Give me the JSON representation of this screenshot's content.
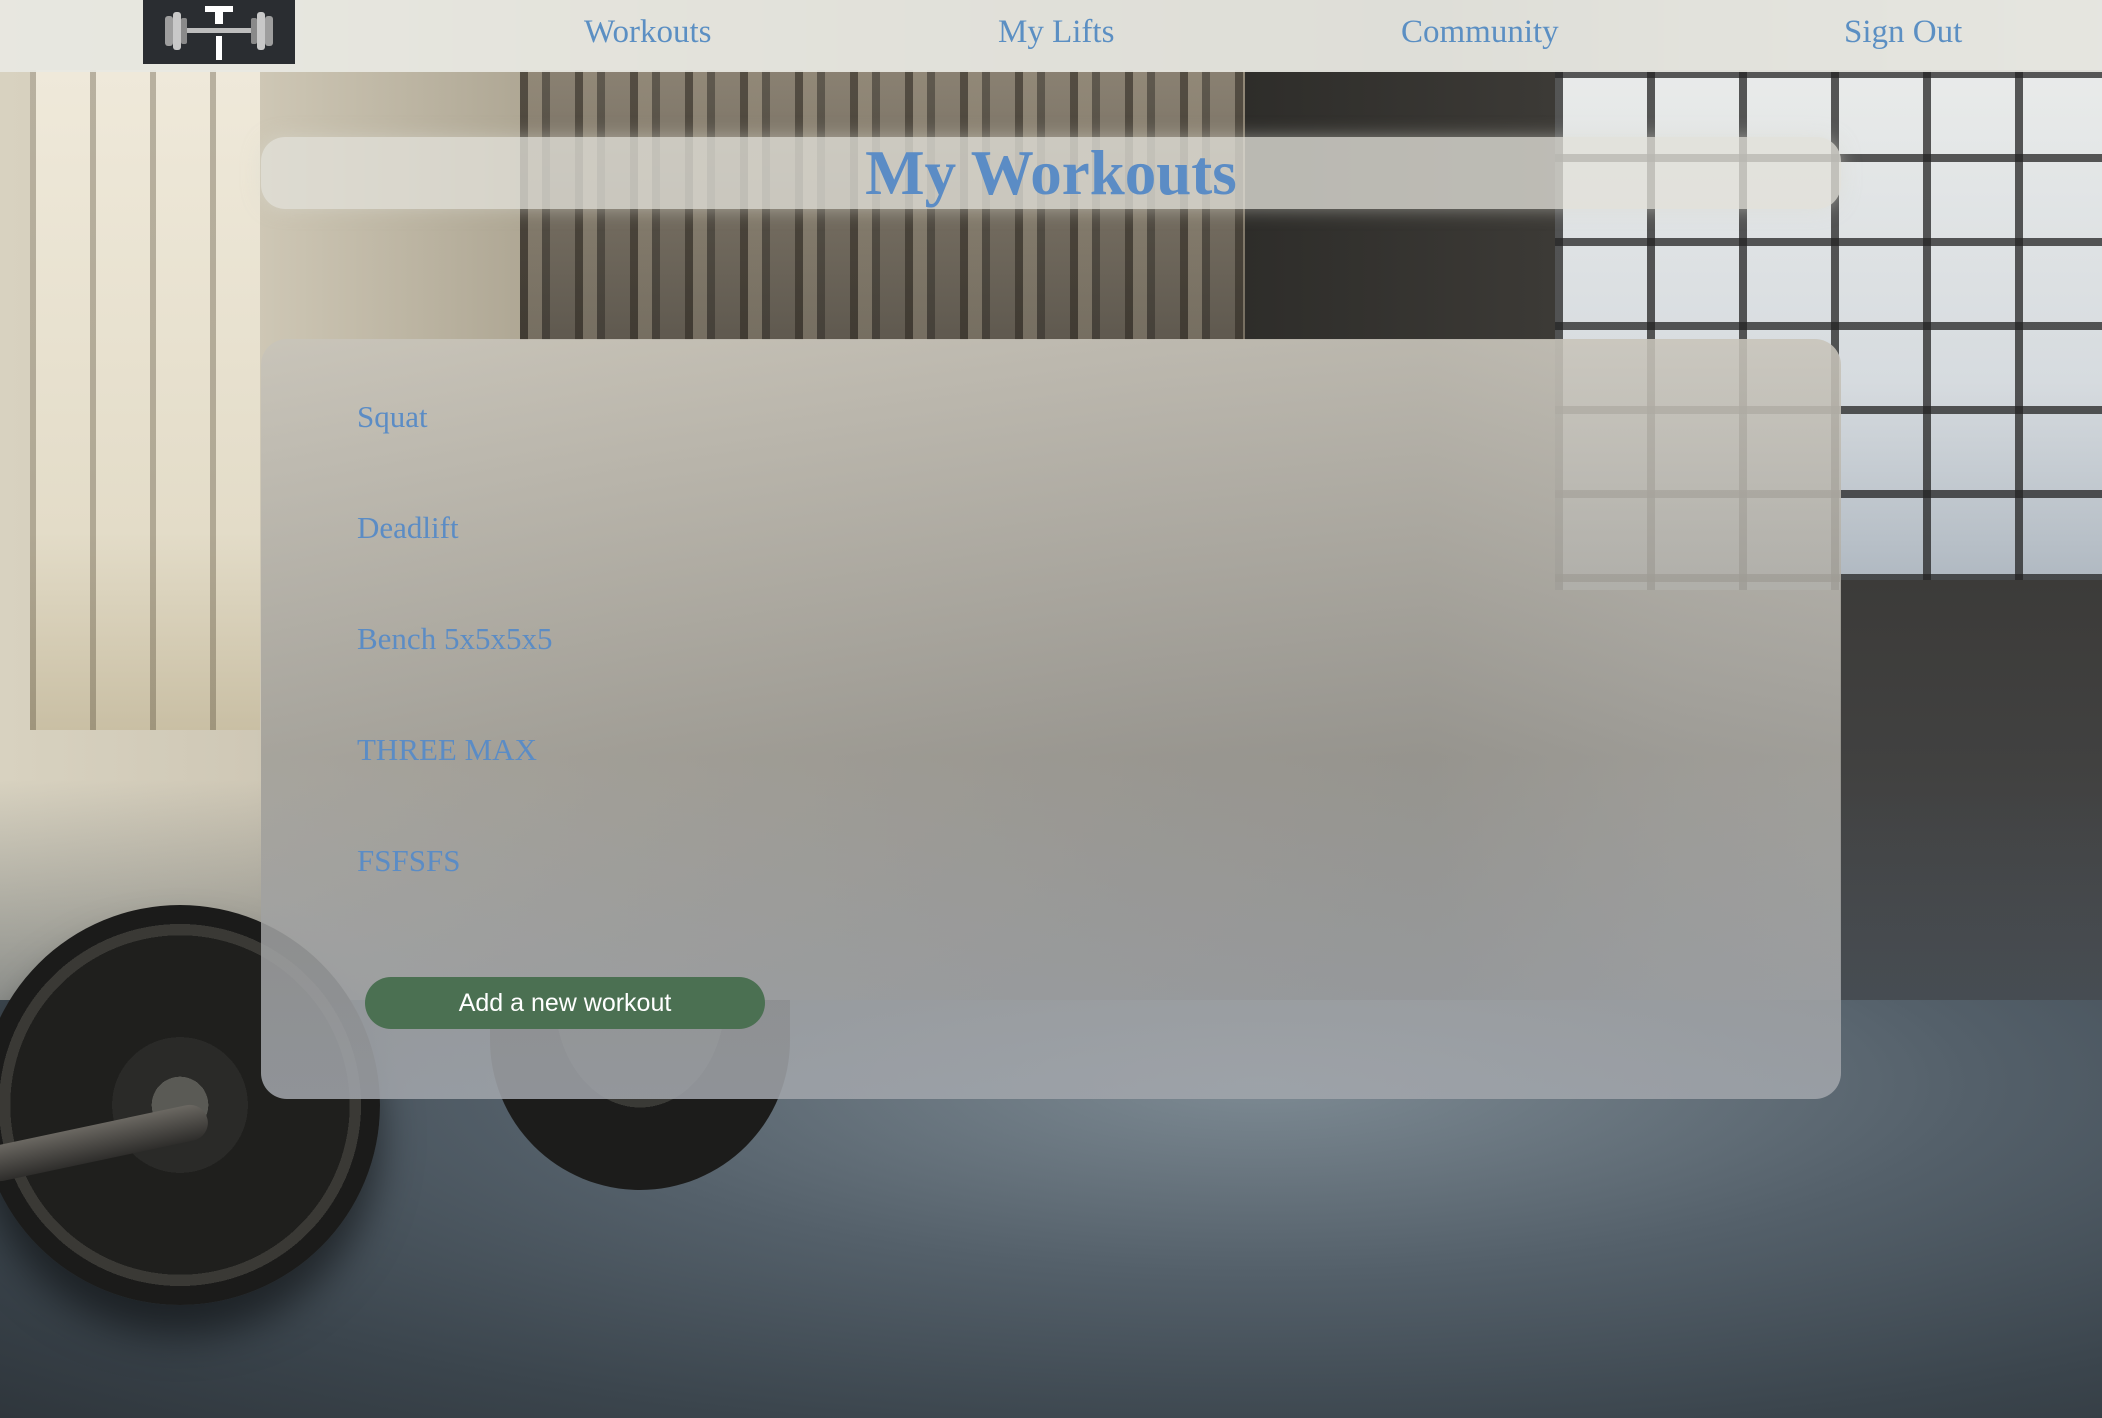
{
  "nav": {
    "logo_icon": "dumbbell-logo-icon",
    "links": [
      {
        "label": "Workouts"
      },
      {
        "label": "My Lifts"
      },
      {
        "label": "Community"
      },
      {
        "label": "Sign Out"
      }
    ]
  },
  "page": {
    "title": "My Workouts"
  },
  "workouts": [
    {
      "name": "Squat"
    },
    {
      "name": "Deadlift"
    },
    {
      "name": "Bench 5x5x5x5"
    },
    {
      "name": "THREE MAX"
    },
    {
      "name": "FSFSFS"
    }
  ],
  "actions": {
    "add_workout_label": "Add a new workout"
  },
  "colors": {
    "link": "#5b8cc5",
    "button": "#4b7052",
    "logo_bg": "#2a2d31"
  }
}
